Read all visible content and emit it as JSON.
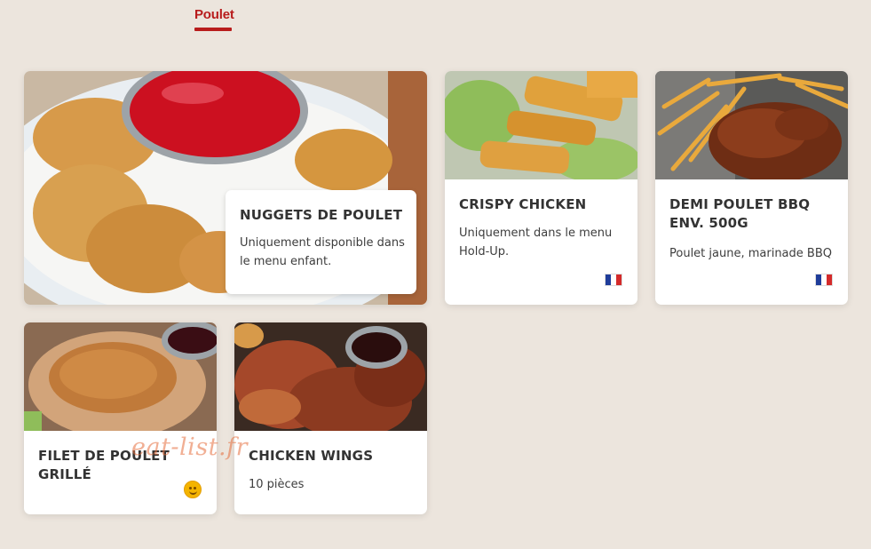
{
  "tab": {
    "label": "Poulet"
  },
  "cards": [
    {
      "title": "Nuggets de poulet",
      "description": "Uniquement disponible dans le menu enfant."
    },
    {
      "title": "Crispy chicken",
      "description": "Uniquement dans le menu Hold-Up.",
      "flag": "france-flag-icon"
    },
    {
      "title": "Demi poulet BBQ env. 500g",
      "description": "Poulet jaune, marinade BBQ",
      "flag": "france-flag-icon"
    },
    {
      "title": "Filet de poulet grillé",
      "badge": "smiley-icon"
    },
    {
      "title": "Chicken wings",
      "description": "10 pièces"
    }
  ],
  "watermark": "eat-list.fr",
  "colors": {
    "background": "#ece5dd",
    "accent": "#b81c1c",
    "flag_blue": "#1f3d9a",
    "flag_white": "#ffffff",
    "flag_red": "#d42a2a"
  }
}
